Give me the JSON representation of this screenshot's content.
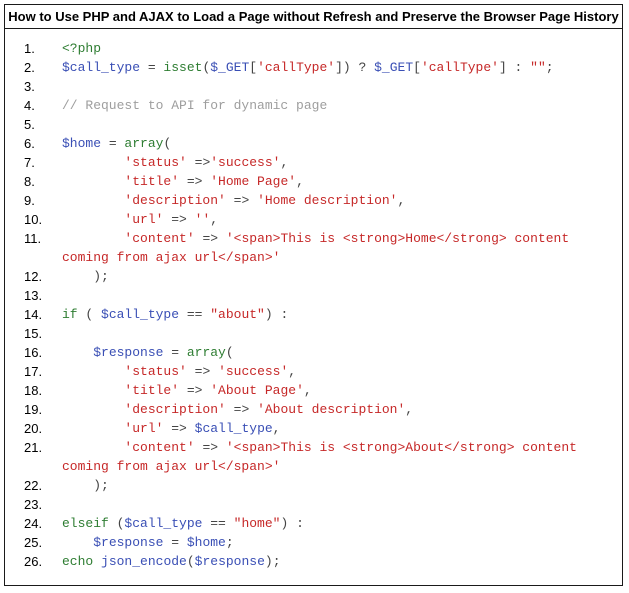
{
  "title": "How to Use PHP and AJAX to Load a Page without Refresh and Preserve the Browser Page History",
  "colors": {
    "keyword": "#2e7d32",
    "variable": "#3a4fb5",
    "string": "#c62828",
    "comment": "#9e9e9e",
    "plain": "#444444"
  },
  "lines": [
    {
      "num": "1.",
      "tokens": [
        {
          "t": "k",
          "s": "<?php"
        }
      ]
    },
    {
      "num": "2.",
      "tokens": [
        {
          "t": "v",
          "s": "$call_type"
        },
        {
          "t": "p",
          "s": " = "
        },
        {
          "t": "k",
          "s": "isset"
        },
        {
          "t": "p",
          "s": "("
        },
        {
          "t": "v",
          "s": "$_GET"
        },
        {
          "t": "p",
          "s": "["
        },
        {
          "t": "s",
          "s": "'callType'"
        },
        {
          "t": "p",
          "s": "]) ? "
        },
        {
          "t": "v",
          "s": "$_GET"
        },
        {
          "t": "p",
          "s": "["
        },
        {
          "t": "s",
          "s": "'callType'"
        },
        {
          "t": "p",
          "s": "] : "
        },
        {
          "t": "s",
          "s": "\"\""
        },
        {
          "t": "p",
          "s": ";"
        }
      ]
    },
    {
      "num": "3.",
      "tokens": []
    },
    {
      "num": "4.",
      "tokens": [
        {
          "t": "c",
          "s": "// Request to API for dynamic page"
        }
      ]
    },
    {
      "num": "5.",
      "tokens": []
    },
    {
      "num": "6.",
      "tokens": [
        {
          "t": "v",
          "s": "$home"
        },
        {
          "t": "p",
          "s": " = "
        },
        {
          "t": "k",
          "s": "array"
        },
        {
          "t": "p",
          "s": "("
        }
      ]
    },
    {
      "num": "7.",
      "tokens": [
        {
          "t": "p",
          "s": "        "
        },
        {
          "t": "s",
          "s": "'status'"
        },
        {
          "t": "p",
          "s": " =>"
        },
        {
          "t": "s",
          "s": "'success'"
        },
        {
          "t": "p",
          "s": ","
        }
      ]
    },
    {
      "num": "8.",
      "tokens": [
        {
          "t": "p",
          "s": "        "
        },
        {
          "t": "s",
          "s": "'title'"
        },
        {
          "t": "p",
          "s": " => "
        },
        {
          "t": "s",
          "s": "'Home Page'"
        },
        {
          "t": "p",
          "s": ","
        }
      ]
    },
    {
      "num": "9.",
      "tokens": [
        {
          "t": "p",
          "s": "        "
        },
        {
          "t": "s",
          "s": "'description'"
        },
        {
          "t": "p",
          "s": " => "
        },
        {
          "t": "s",
          "s": "'Home description'"
        },
        {
          "t": "p",
          "s": ","
        }
      ]
    },
    {
      "num": "10.",
      "tokens": [
        {
          "t": "p",
          "s": "        "
        },
        {
          "t": "s",
          "s": "'url'"
        },
        {
          "t": "p",
          "s": " => "
        },
        {
          "t": "s",
          "s": "''"
        },
        {
          "t": "p",
          "s": ","
        }
      ]
    },
    {
      "num": "11.",
      "tokens": [
        {
          "t": "p",
          "s": "        "
        },
        {
          "t": "s",
          "s": "'content'"
        },
        {
          "t": "p",
          "s": " => "
        },
        {
          "t": "s",
          "s": "'<span>This is <strong>Home</strong> content coming from ajax url</span>'"
        }
      ]
    },
    {
      "num": "12.",
      "tokens": [
        {
          "t": "p",
          "s": "    );"
        }
      ]
    },
    {
      "num": "13.",
      "tokens": []
    },
    {
      "num": "14.",
      "tokens": [
        {
          "t": "k",
          "s": "if"
        },
        {
          "t": "p",
          "s": " ( "
        },
        {
          "t": "v",
          "s": "$call_type"
        },
        {
          "t": "p",
          "s": " == "
        },
        {
          "t": "s",
          "s": "\"about\""
        },
        {
          "t": "p",
          "s": ") :"
        }
      ]
    },
    {
      "num": "15.",
      "tokens": []
    },
    {
      "num": "16.",
      "tokens": [
        {
          "t": "p",
          "s": "    "
        },
        {
          "t": "v",
          "s": "$response"
        },
        {
          "t": "p",
          "s": " = "
        },
        {
          "t": "k",
          "s": "array"
        },
        {
          "t": "p",
          "s": "("
        }
      ]
    },
    {
      "num": "17.",
      "tokens": [
        {
          "t": "p",
          "s": "        "
        },
        {
          "t": "s",
          "s": "'status'"
        },
        {
          "t": "p",
          "s": " => "
        },
        {
          "t": "s",
          "s": "'success'"
        },
        {
          "t": "p",
          "s": ","
        }
      ]
    },
    {
      "num": "18.",
      "tokens": [
        {
          "t": "p",
          "s": "        "
        },
        {
          "t": "s",
          "s": "'title'"
        },
        {
          "t": "p",
          "s": " => "
        },
        {
          "t": "s",
          "s": "'About Page'"
        },
        {
          "t": "p",
          "s": ","
        }
      ]
    },
    {
      "num": "19.",
      "tokens": [
        {
          "t": "p",
          "s": "        "
        },
        {
          "t": "s",
          "s": "'description'"
        },
        {
          "t": "p",
          "s": " => "
        },
        {
          "t": "s",
          "s": "'About description'"
        },
        {
          "t": "p",
          "s": ","
        }
      ]
    },
    {
      "num": "20.",
      "tokens": [
        {
          "t": "p",
          "s": "        "
        },
        {
          "t": "s",
          "s": "'url'"
        },
        {
          "t": "p",
          "s": " => "
        },
        {
          "t": "v",
          "s": "$call_type"
        },
        {
          "t": "p",
          "s": ","
        }
      ]
    },
    {
      "num": "21.",
      "tokens": [
        {
          "t": "p",
          "s": "        "
        },
        {
          "t": "s",
          "s": "'content'"
        },
        {
          "t": "p",
          "s": " => "
        },
        {
          "t": "s",
          "s": "'<span>This is <strong>About</strong> content coming from ajax url</span>'"
        }
      ]
    },
    {
      "num": "22.",
      "tokens": [
        {
          "t": "p",
          "s": "    );"
        }
      ]
    },
    {
      "num": "23.",
      "tokens": []
    },
    {
      "num": "24.",
      "tokens": [
        {
          "t": "k",
          "s": "elseif"
        },
        {
          "t": "p",
          "s": " ("
        },
        {
          "t": "v",
          "s": "$call_type"
        },
        {
          "t": "p",
          "s": " == "
        },
        {
          "t": "s",
          "s": "\"home\""
        },
        {
          "t": "p",
          "s": ") :"
        }
      ]
    },
    {
      "num": "25.",
      "tokens": [
        {
          "t": "p",
          "s": "    "
        },
        {
          "t": "v",
          "s": "$response"
        },
        {
          "t": "p",
          "s": " = "
        },
        {
          "t": "v",
          "s": "$home"
        },
        {
          "t": "p",
          "s": ";"
        }
      ]
    },
    {
      "num": "26.",
      "tokens": [
        {
          "t": "k",
          "s": "echo"
        },
        {
          "t": "p",
          "s": " "
        },
        {
          "t": "v",
          "s": "json_encode"
        },
        {
          "t": "p",
          "s": "("
        },
        {
          "t": "v",
          "s": "$response"
        },
        {
          "t": "p",
          "s": ");"
        }
      ]
    }
  ]
}
